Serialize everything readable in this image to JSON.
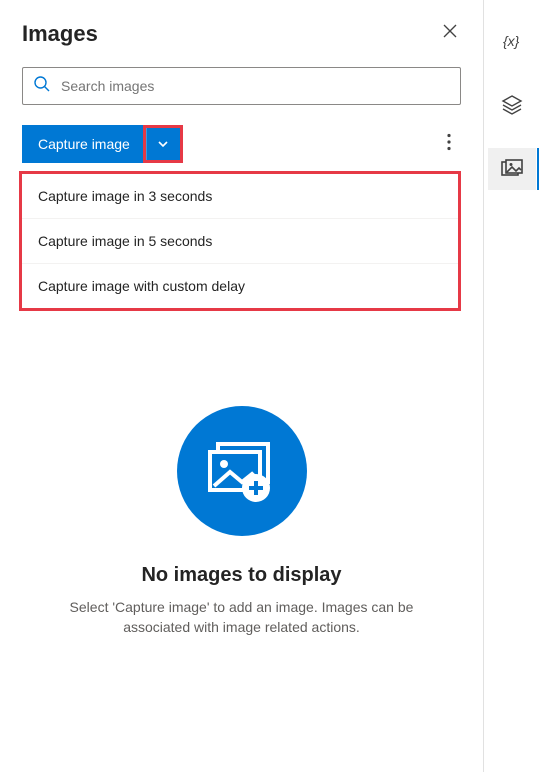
{
  "header": {
    "title": "Images"
  },
  "search": {
    "placeholder": "Search images"
  },
  "toolbar": {
    "capture_label": "Capture image"
  },
  "dropdown": {
    "items": [
      {
        "label": "Capture image in 3 seconds"
      },
      {
        "label": "Capture image in 5 seconds"
      },
      {
        "label": "Capture image with custom delay"
      }
    ]
  },
  "empty_state": {
    "title": "No images to display",
    "subtitle": "Select 'Capture image' to add an image. Images can be associated with image related actions."
  },
  "rail": {
    "variables_label": "variables-icon",
    "layers_label": "layers-icon",
    "images_label": "images-icon"
  }
}
